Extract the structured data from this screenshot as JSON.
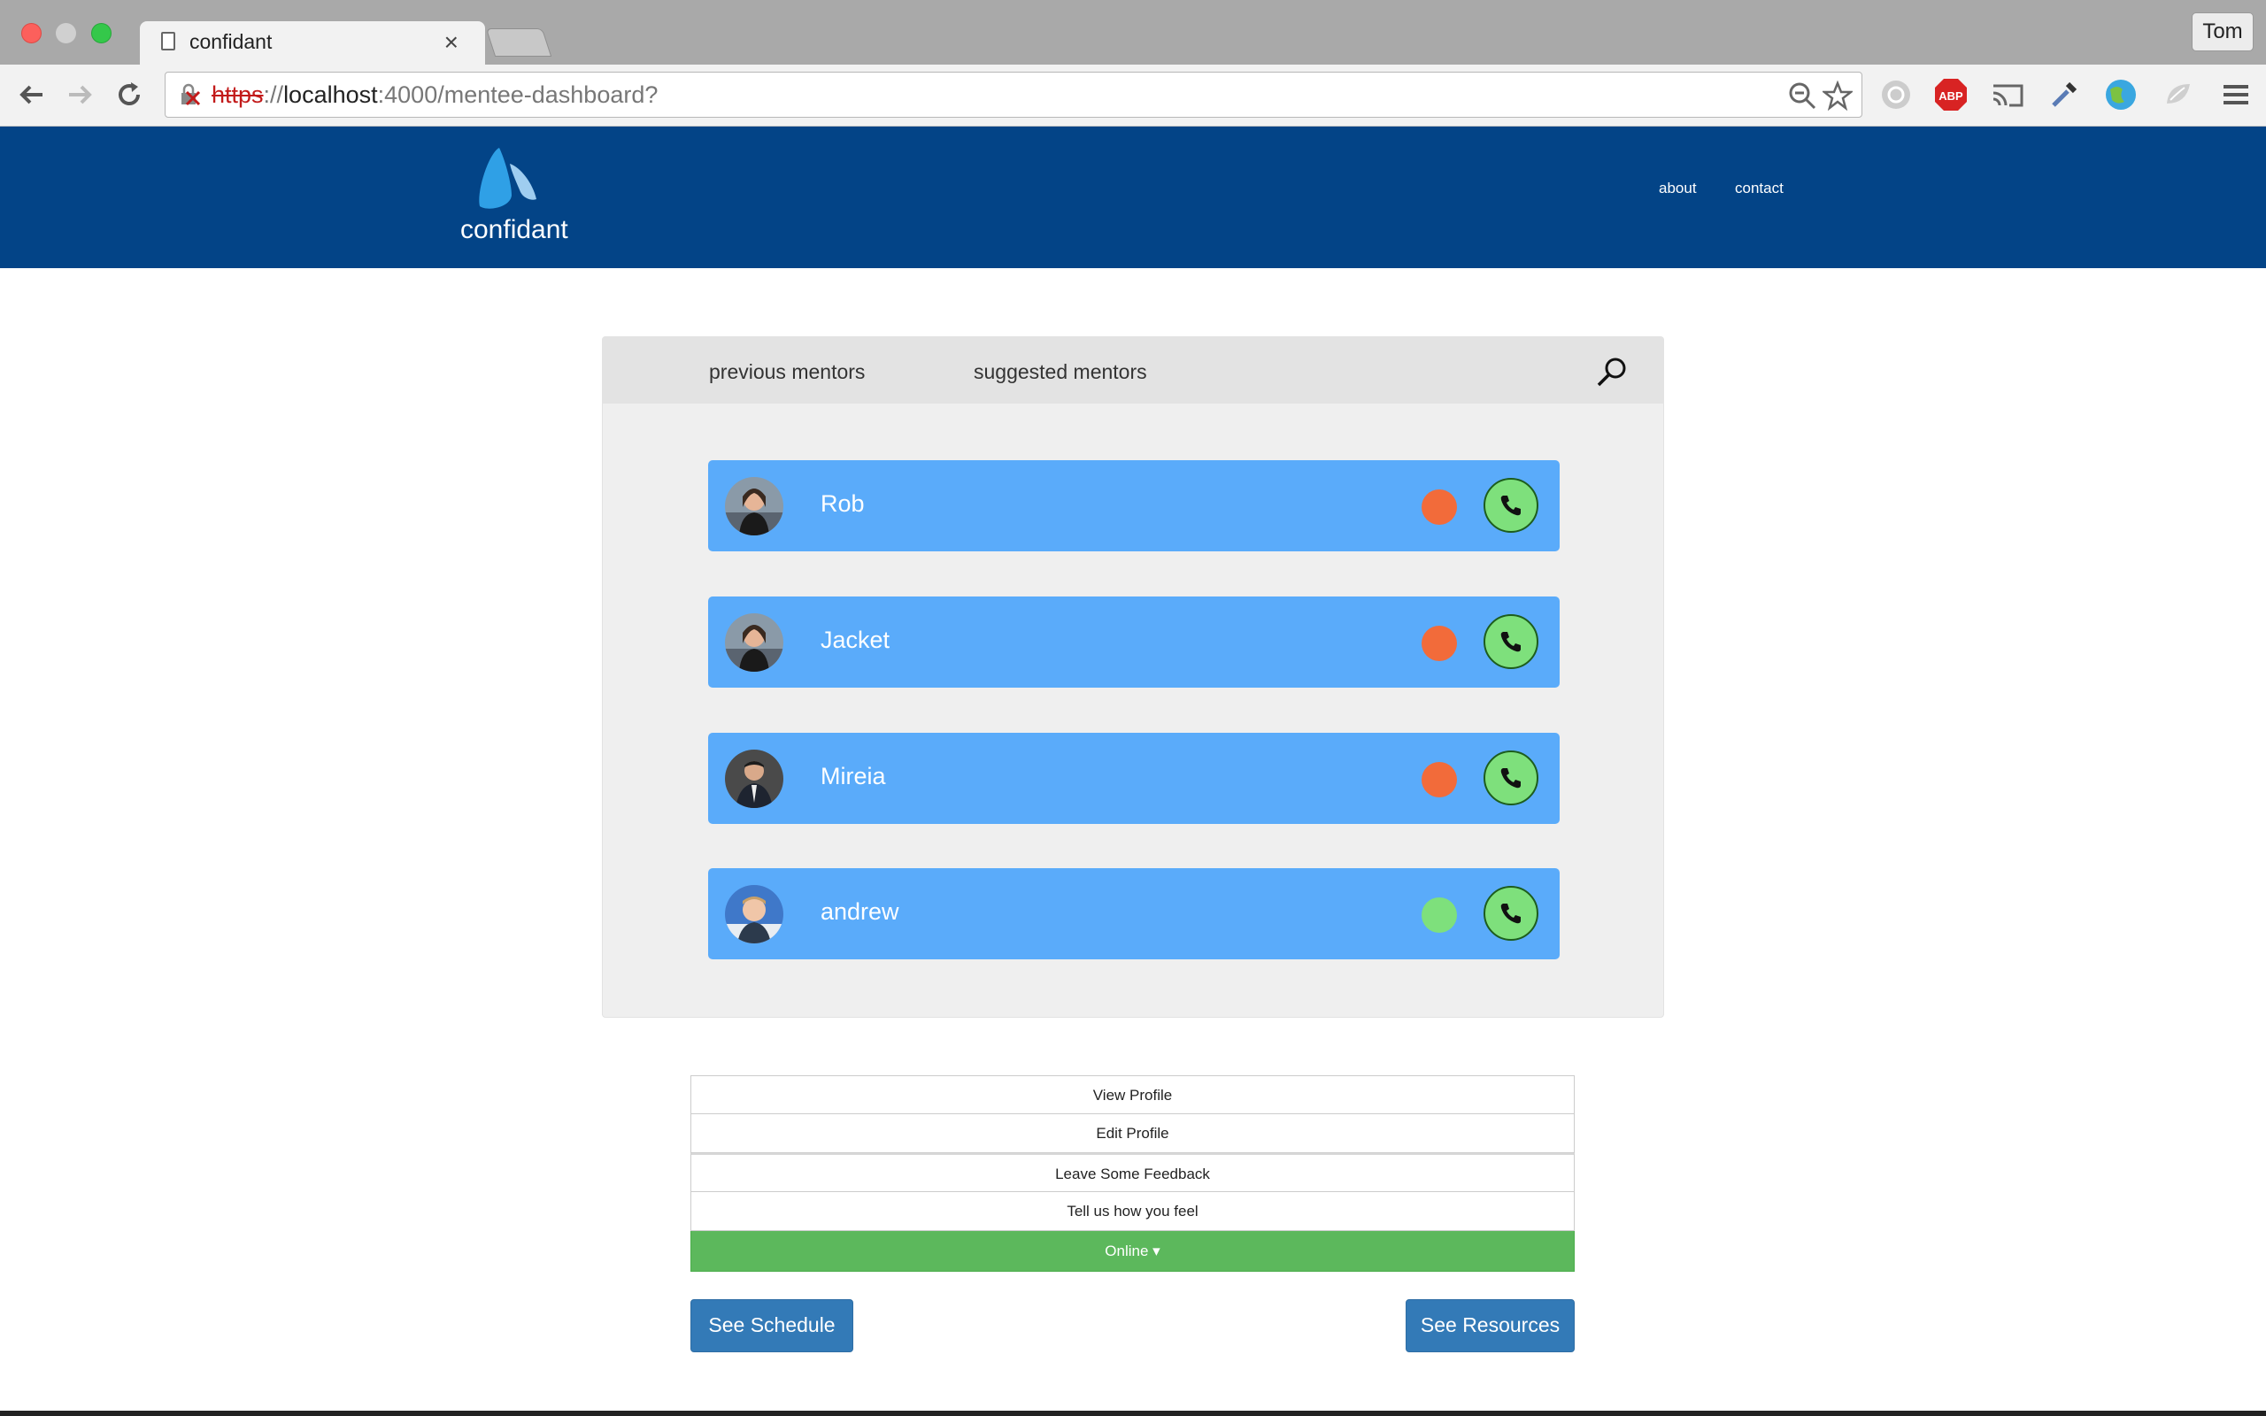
{
  "browser": {
    "tab_title": "confidant",
    "tab_close": "×",
    "profile_name": "Tom",
    "url_scheme": "https",
    "url_sep": "://",
    "url_host": "localhost",
    "url_rest": ":4000/mentee-dashboard?",
    "ext_abp_label": "ABP"
  },
  "site": {
    "logo_text": "confidant",
    "nav": [
      "about",
      "contact"
    ]
  },
  "panel": {
    "tabs": [
      "previous mentors",
      "suggested mentors"
    ],
    "mentors": [
      {
        "name": "Rob",
        "status": "busy",
        "status_color": "#f26b3a"
      },
      {
        "name": "Jacket",
        "status": "busy",
        "status_color": "#f26b3a"
      },
      {
        "name": "Mireia",
        "status": "busy",
        "status_color": "#f26b3a"
      },
      {
        "name": "andrew",
        "status": "online",
        "status_color": "#7ee07c"
      }
    ]
  },
  "menu": {
    "items": [
      "View Profile",
      "Edit Profile",
      "Leave Some Feedback",
      "Tell us how you feel"
    ],
    "status_dropdown": "Online ▾"
  },
  "buttons": {
    "schedule": "See Schedule",
    "resources": "See Resources"
  },
  "colors": {
    "header_bg": "#034487",
    "mentor_card": "#5aabfa",
    "call_green": "#7ee07c",
    "online_bar": "#5cb85c",
    "primary_button": "#337ab7"
  }
}
